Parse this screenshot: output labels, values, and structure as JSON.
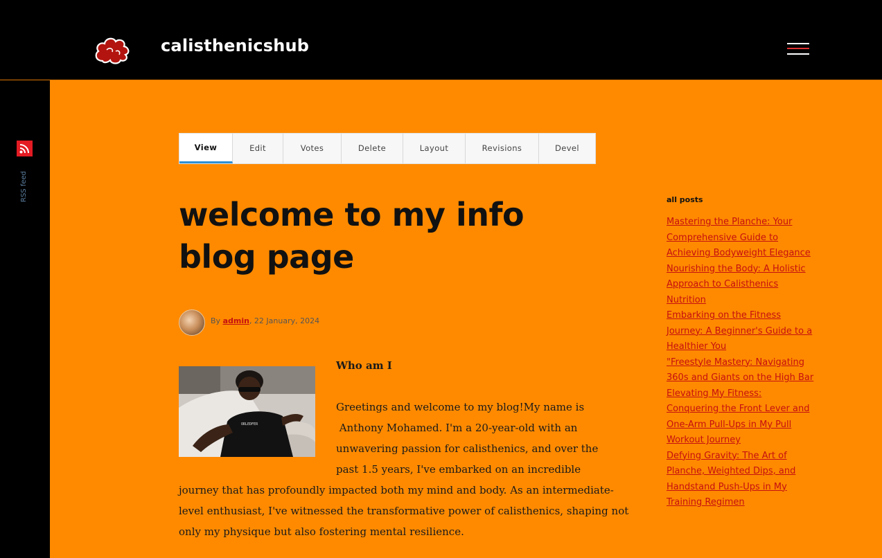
{
  "header": {
    "site_name": "calisthenicshub",
    "logo_icon": "red-cloud-logo-icon",
    "menu_icon": "hamburger-menu-icon"
  },
  "left_rail": {
    "rss_label": "RSS feed",
    "rss_icon": "rss-icon"
  },
  "tabs": [
    {
      "label": "View",
      "active": true
    },
    {
      "label": "Edit",
      "active": false
    },
    {
      "label": "Votes",
      "active": false
    },
    {
      "label": "Delete",
      "active": false
    },
    {
      "label": "Layout",
      "active": false
    },
    {
      "label": "Revisions",
      "active": false
    },
    {
      "label": "Devel",
      "active": false
    }
  ],
  "post": {
    "title_line1": "welcome to my info",
    "title_line2": "blog page",
    "byline_prefix": "By",
    "author": "admin",
    "date": ", 22 January, 2024",
    "subhead": "Who am I",
    "lines_beside_image": [
      "Greetings and welcome to my blog!My name  is",
      " Anthony Mohamed. I'm a 20-year-old with an",
      "unwavering passion for calisthenics, and over the",
      "past 1.5 years, I've embarked on an incredible"
    ],
    "lines_full": [
      "journey that has profoundly impacted both my mind and body. As an intermediate-",
      "level enthusiast, I've witnessed the transformative power of calisthenics, shaping not",
      "only my physique but also fostering mental resilience."
    ]
  },
  "sidebar": {
    "title": "all posts",
    "links": [
      "Mastering the Planche: Your Comprehensive Guide to Achieving Bodyweight Elegance",
      "Nourishing the Body: A Holistic Approach to Calisthenics Nutrition",
      "Embarking on the Fitness Journey: A Beginner's Guide to a Healthier You",
      "\"Freestyle Mastery: Navigating 360s and Giants on the High Bar",
      "Elevating My Fitness: Conquering the Front Lever and One-Arm Pull-Ups in My Pull Workout Journey",
      "Defying Gravity: The Art of Planche, Weighted Dips, and Handstand Push-Ups in My Training Regimen"
    ]
  },
  "colors": {
    "background": "#ff8a00",
    "header": "#000000",
    "link": "#c51010",
    "tab_active_underline": "#2d8fd5",
    "rss": "#e31b23"
  }
}
